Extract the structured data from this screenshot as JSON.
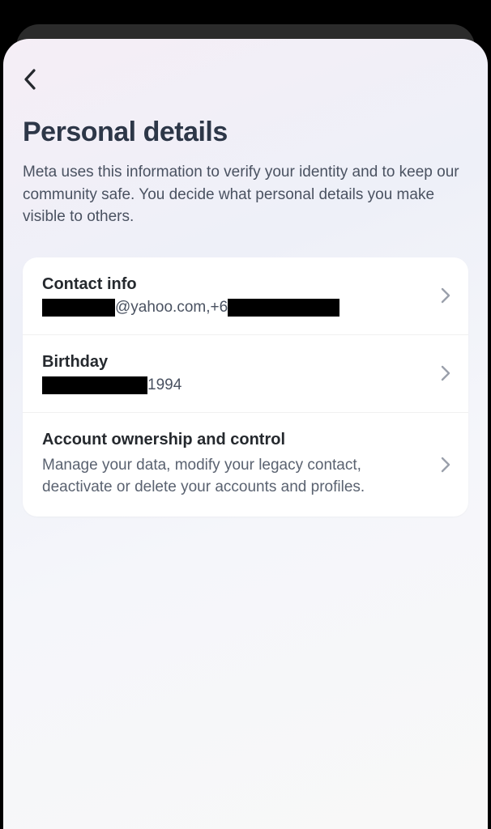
{
  "header": {
    "title": "Personal details",
    "subtitle": "Meta uses this information to verify your identity and to keep our community safe. You decide what personal details you make visible to others."
  },
  "rows": {
    "contact": {
      "title": "Contact info",
      "email_suffix": "@yahoo.com, ",
      "phone_prefix": "+6"
    },
    "birthday": {
      "title": "Birthday",
      "year": " 1994"
    },
    "ownership": {
      "title": "Account ownership and control",
      "subtitle": "Manage your data, modify your legacy contact, deactivate or delete your accounts and profiles."
    }
  }
}
